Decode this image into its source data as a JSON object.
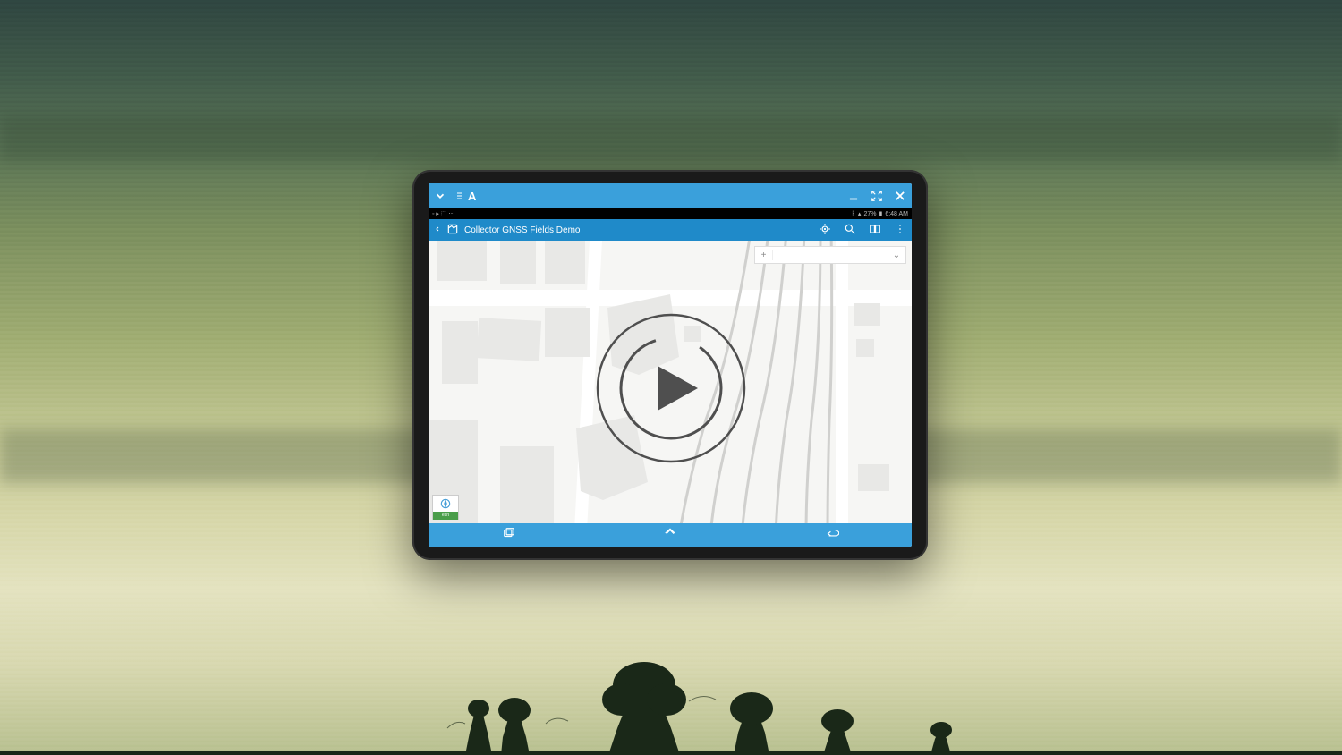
{
  "mirror_bar": {
    "letter": "A"
  },
  "android_status": {
    "battery_text": "27%",
    "time": "6:48 AM"
  },
  "app_header": {
    "title": "Collector GNSS Fields Demo"
  },
  "layer_panel": {
    "plus": "+",
    "chevron": "⌄"
  },
  "attribution": {
    "label": "esri"
  },
  "location_dot": {
    "visible": true
  }
}
